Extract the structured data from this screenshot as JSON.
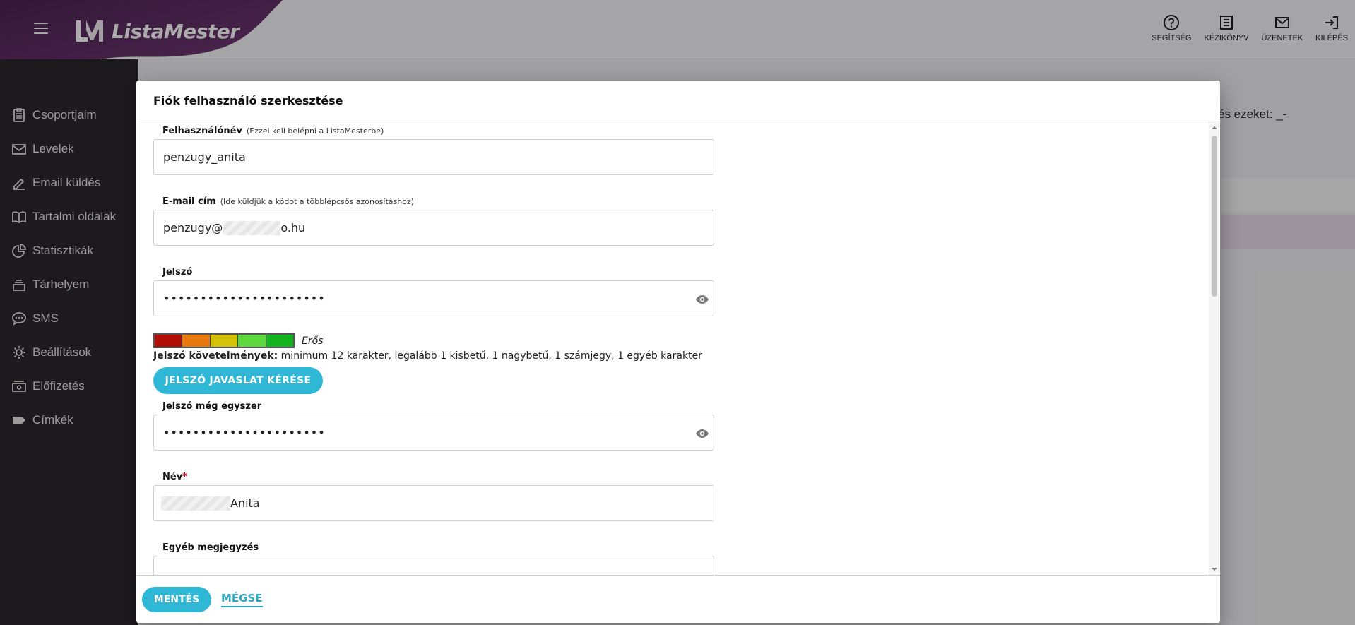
{
  "app": {
    "brand": "ListaMester",
    "logo_icon": "lm-logo-icon",
    "menu_icon": "hamburger-icon"
  },
  "top_actions": [
    {
      "label": "SEGÍTSÉG",
      "icon": "help-icon"
    },
    {
      "label": "KÉZIKÖNYV",
      "icon": "manual-icon"
    },
    {
      "label": "ÜZENETEK",
      "icon": "mail-icon"
    },
    {
      "label": "KILÉPÉS",
      "icon": "logout-icon"
    }
  ],
  "sidebar": {
    "items": [
      {
        "label": "Csoportjaim",
        "icon": "clipboard-icon"
      },
      {
        "label": "Levelek",
        "icon": "envelope-icon"
      },
      {
        "label": "Email küldés",
        "icon": "pencil-icon"
      },
      {
        "label": "Tartalmi oldalak",
        "icon": "book-icon"
      },
      {
        "label": "Statisztikák",
        "icon": "pie-chart-icon"
      },
      {
        "label": "Tárhelyem",
        "icon": "storage-icon"
      },
      {
        "label": "SMS",
        "icon": "chat-icon"
      },
      {
        "label": "Beállítások",
        "icon": "gear-icon"
      },
      {
        "label": "Előfizetés",
        "icon": "cash-icon"
      },
      {
        "label": "Címkék",
        "icon": "tag-icon"
      }
    ]
  },
  "background": {
    "hint_fragment": "és ezeket: _-"
  },
  "modal": {
    "title": "Fiók felhasználó szerkesztése",
    "username": {
      "label": "Felhasználónév",
      "hint": "(Ezzel kell belépni a ListaMesterbe)",
      "value": "penzugy_anita"
    },
    "email": {
      "label": "E-mail cím",
      "hint": "(Ide küldjük a kódot a többlépcsős azonosításhoz)",
      "value_prefix": "penzugy@",
      "value_suffix": "o.hu"
    },
    "password": {
      "label": "Jelszó",
      "value": "••••••••••••••••••••••"
    },
    "strength": {
      "label": "Erős",
      "segment_colors": [
        "#b01005",
        "#e6780d",
        "#d4c20a",
        "#5dd83d",
        "#14b41e"
      ],
      "level": 5,
      "max": 5
    },
    "requirements": {
      "label": "Jelszó követelmények:",
      "text": " minimum 12 karakter, legalább 1 kisbetű, 1 nagybetű, 1 számjegy, 1 egyéb karakter"
    },
    "suggest_button": "JELSZÓ JAVASLAT KÉRÉSE",
    "password_confirm": {
      "label": "Jelszó még egyszer",
      "value": "••••••••••••••••••••••"
    },
    "name": {
      "label": "Név",
      "required_mark": "*",
      "value_suffix": "Anita"
    },
    "note": {
      "label": "Egyéb megjegyzés"
    },
    "save_button": "MENTÉS",
    "cancel_link": "MÉGSE"
  },
  "colors": {
    "accent": "#2fb8d6",
    "sidebar_bg": "#2a272e",
    "brand_purple": "#5e2a5f"
  }
}
